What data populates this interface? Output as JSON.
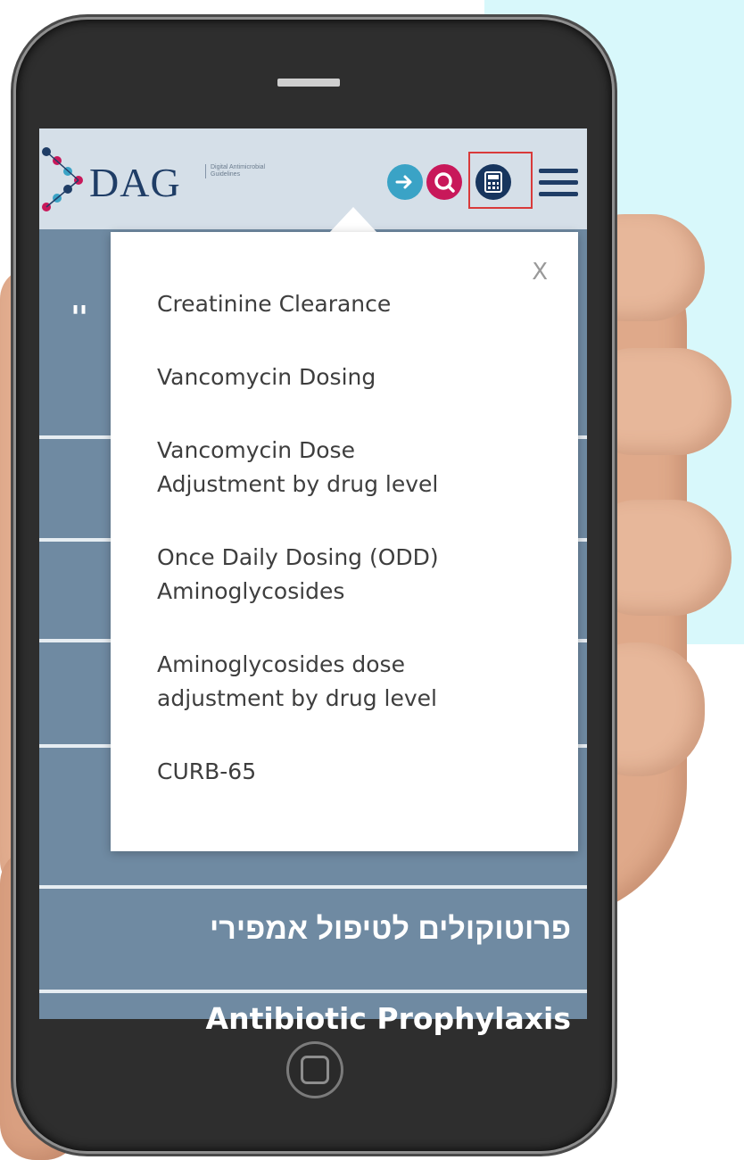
{
  "header": {
    "logo_text": "DAG",
    "logo_subtitle": "Digital Antimicrobial Guidelines"
  },
  "icons": {
    "arrow": "arrow-right-circle-icon",
    "search": "search-icon",
    "calculator": "calculator-icon",
    "menu": "hamburger-menu-icon"
  },
  "dropdown": {
    "close_label": "X",
    "items": [
      {
        "line1": "Creatinine Clearance",
        "line2": ""
      },
      {
        "line1": "Vancomycin Dosing",
        "line2": ""
      },
      {
        "line1": "Vancomycin Dose",
        "line2": "Adjustment by drug level"
      },
      {
        "line1": "Once Daily Dosing (ODD)",
        "line2": "Aminoglycosides"
      },
      {
        "line1": "Aminoglycosides dose",
        "line2": "adjustment by drug level"
      },
      {
        "line1": "CURB-65",
        "line2": ""
      }
    ]
  },
  "menu": {
    "partial_row": "יי",
    "empiric_protocols": "פרוטוקולים לטיפול אמפירי",
    "antibiotic_prophylaxis": "Antibiotic Prophylaxis"
  },
  "colors": {
    "screen_bg": "#6f8aa2",
    "header_bg": "#d5dfe8",
    "brand_navy": "#1f3d66",
    "highlight": "#d93a3a",
    "accent_blue": "#3aa3c6",
    "accent_magenta": "#c8185a"
  }
}
